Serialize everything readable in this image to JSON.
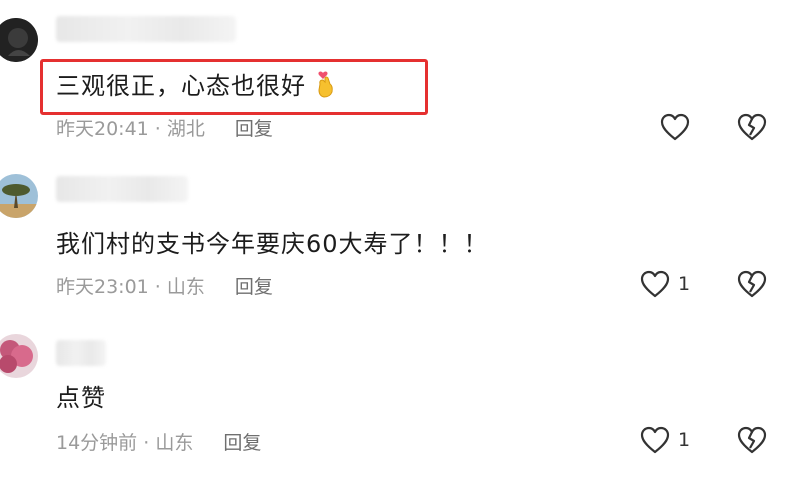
{
  "comments": [
    {
      "text": "三观很正，心态也很好",
      "time": "昨天20:41",
      "location": "湖北",
      "reply": "回复",
      "likes": ""
    },
    {
      "text": "我们村的支书今年要庆60大寿了！！！",
      "time": "昨天23:01",
      "location": "山东",
      "reply": "回复",
      "likes": "1"
    },
    {
      "text": "点赞",
      "time": "14分钟前",
      "location": "山东",
      "reply": "回复",
      "likes": "1"
    }
  ],
  "separator": " · ",
  "icons": {
    "like": "heart-outline-icon",
    "dislike": "broken-heart-icon",
    "emoji": "finger-heart-emoji-icon"
  },
  "colors": {
    "highlight_border": "#e53030",
    "meta_text": "#9a9a9a",
    "body_text": "#1c1c1c"
  }
}
